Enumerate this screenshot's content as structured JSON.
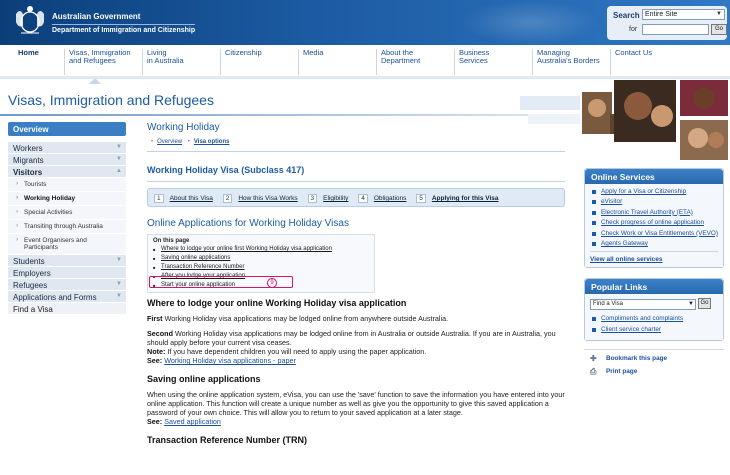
{
  "header": {
    "gov_name": "Australian Government",
    "dept_name": "Department of Immigration and Citizenship",
    "search": {
      "label": "Search",
      "scope_value": "Entire Site",
      "for_label": "for",
      "query": "",
      "go_label": "Go"
    }
  },
  "topnav": [
    {
      "line1": "Home",
      "line2": ""
    },
    {
      "line1": "Visas, Immigration",
      "line2": "and Refugees"
    },
    {
      "line1": "Living",
      "line2": "in Australia"
    },
    {
      "line1": "Citizenship",
      "line2": ""
    },
    {
      "line1": "Media",
      "line2": ""
    },
    {
      "line1": "About the",
      "line2": "Department"
    },
    {
      "line1": "Business",
      "line2": "Services"
    },
    {
      "line1": "Managing",
      "line2": "Australia's Borders"
    },
    {
      "line1": "Contact Us",
      "line2": ""
    }
  ],
  "page_title": "Visas, Immigration and Refugees",
  "leftnav": {
    "overview": "Overview",
    "items": [
      "Workers",
      "Migrants",
      "Visitors"
    ],
    "subitems": [
      "Tourists",
      "Working Holiday",
      "Special Activities",
      "Transiting through Australia",
      "Event Organisers and Participants"
    ],
    "items_after": [
      "Students",
      "Employers",
      "Refugees",
      "Applications and Forms",
      "Find a Visa"
    ]
  },
  "main": {
    "heading": "Working Holiday",
    "subnav": {
      "overview": "Overview",
      "visa_options": "Visa options"
    },
    "visa_heading": "Working Holiday Visa (Subclass 417)",
    "steps": [
      {
        "num": "1",
        "label": "About this Visa"
      },
      {
        "num": "2",
        "label": "How this Visa Works"
      },
      {
        "num": "3",
        "label": "Eligibility"
      },
      {
        "num": "4",
        "label": "Obligations"
      },
      {
        "num": "5",
        "label": "Applying for this Visa"
      }
    ],
    "online_heading": "Online Applications for Working Holiday Visas",
    "on_this_page": {
      "title": "On this page",
      "links": [
        "Where to lodge your online first Working Holiday visa application",
        "Saving online applications",
        "Transaction Reference Number",
        "After you lodge your application",
        "Start your online application"
      ],
      "badge": "9"
    },
    "section1": {
      "heading": "Where to lodge your online Working Holiday visa application",
      "p1_bold": "First",
      "p1_rest": " Working Holiday visa applications may be lodged online from anywhere outside Australia.",
      "p2_bold": "Second",
      "p2_rest": " Working Holiday visa applications may be lodged online from in Australia or outside Australia. If you are in Australia, you should apply before your current visa ceases.",
      "note_bold": "Note:",
      "note_rest": " If you have dependent children you will need to apply using the paper application.",
      "see_bold": "See:",
      "see_link": "Working Holiday visa applications - paper"
    },
    "section2": {
      "heading": "Saving online applications",
      "para": "When using the online application system, eVisa, you can use the 'save' function to save the information you have entered into your online application. This function will create a unique number as well as give you the opportunity to give this saved application a password of your own choice. This will allow you to return to your saved application at a later stage.",
      "see_bold": "See:",
      "see_link": "Saved application"
    },
    "section3": {
      "heading": "Transaction Reference Number (TRN)"
    }
  },
  "online_services": {
    "title": "Online Services",
    "links": [
      "Apply for a Visa or Citizenship",
      "eVisitor",
      "Electronic Travel Authority (ETA)",
      "Check progress of online application",
      "Check Work or Visa Entitlements (VEVO)",
      "Agents Gateway"
    ],
    "view_all": "View all online services"
  },
  "popular_links": {
    "title": "Popular Links",
    "select_value": "Find a Visa",
    "go_label": "Go",
    "links": [
      "Compliments and complaints",
      "Client service charter"
    ]
  },
  "tools": {
    "bookmark": "Bookmark this page",
    "print": "Print page"
  }
}
